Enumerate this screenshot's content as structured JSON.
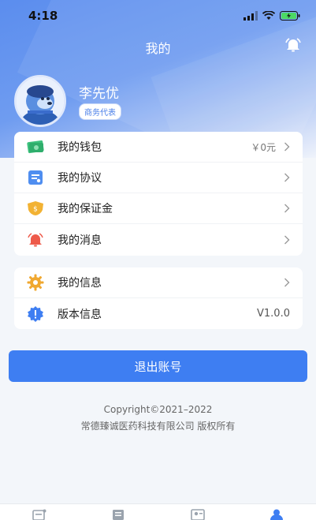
{
  "status_bar": {
    "time": "4:18"
  },
  "header": {
    "title": "我的"
  },
  "user": {
    "name": "李先优",
    "role": "商务代表"
  },
  "menu_group_1": [
    {
      "label": "我的钱包",
      "value": "￥0元",
      "icon": "wallet-icon"
    },
    {
      "label": "我的协议",
      "value": "",
      "icon": "document-icon"
    },
    {
      "label": "我的保证金",
      "value": "",
      "icon": "deposit-icon"
    },
    {
      "label": "我的消息",
      "value": "",
      "icon": "bell-icon"
    }
  ],
  "menu_group_2": [
    {
      "label": "我的信息",
      "value": "",
      "icon": "gear-icon"
    },
    {
      "label": "版本信息",
      "value": "V1.0.0",
      "icon": "info-icon"
    }
  ],
  "logout_label": "退出账号",
  "footer": {
    "copyright": "Copyright©2021–2022",
    "company": "常德臻诚医药科技有限公司  版权所有"
  },
  "colors": {
    "accent": "#3e7ef2",
    "header_gradient_start": "#5b8dee"
  },
  "tabbar": {
    "icons": [
      "home-tab-icon",
      "list-tab-icon",
      "contacts-tab-icon",
      "profile-tab-icon"
    ]
  }
}
